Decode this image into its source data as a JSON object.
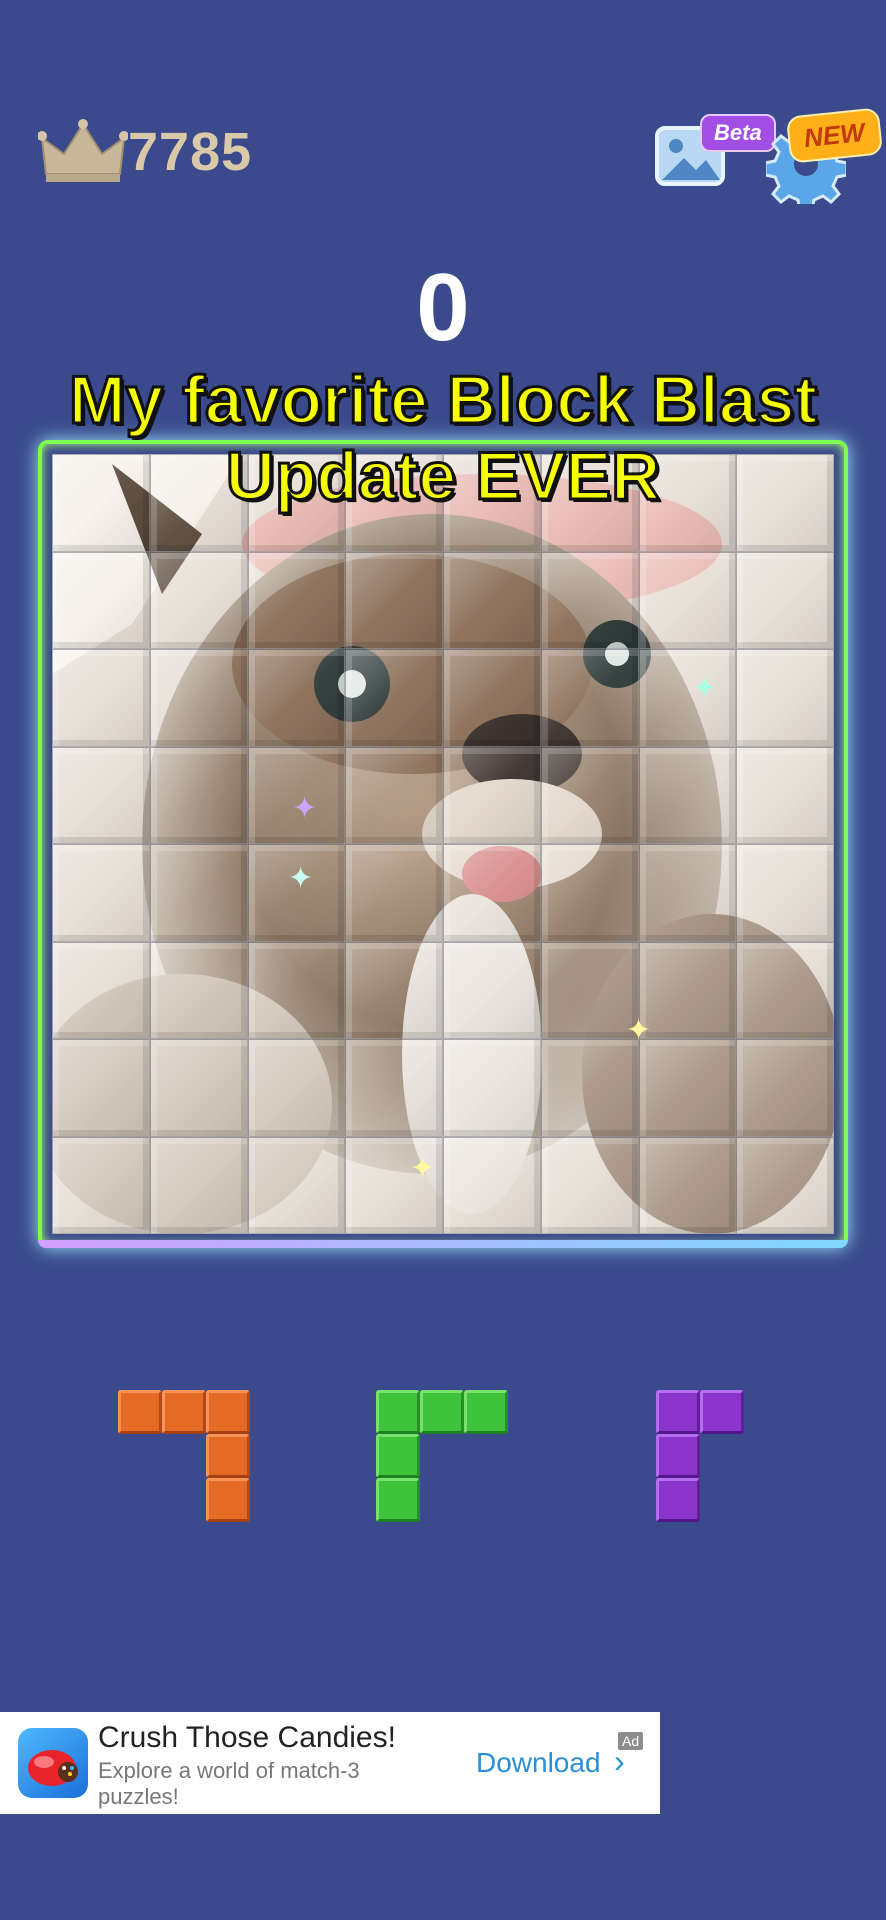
{
  "header": {
    "best_score": "7785",
    "crown_icon": "crown-icon",
    "gallery_icon": "image-gallery-icon",
    "gallery_badge": "Beta",
    "settings_icon": "gear-icon",
    "settings_badge": "NEW"
  },
  "game": {
    "score": "0",
    "board_size": "8x8",
    "board_image": "cat photo",
    "pieces": [
      {
        "color": "orange",
        "color_hex": "#e56b25",
        "shape": [
          [
            1,
            1,
            1
          ],
          [
            0,
            0,
            1
          ],
          [
            0,
            0,
            1
          ]
        ]
      },
      {
        "color": "green",
        "color_hex": "#3ec43a",
        "shape": [
          [
            1,
            1,
            1
          ],
          [
            1,
            0,
            0
          ],
          [
            1,
            0,
            0
          ]
        ]
      },
      {
        "color": "purple",
        "color_hex": "#8a34cc",
        "shape": [
          [
            1,
            1
          ],
          [
            1,
            0
          ],
          [
            1,
            0
          ]
        ]
      }
    ]
  },
  "overlay": {
    "caption_line1": "My favorite Block Blast",
    "caption_line2": "Update EVER"
  },
  "ad": {
    "title": "Crush Those Candies!",
    "description": "Explore a world of match-3 puzzles!",
    "cta": "Download",
    "tag": "Ad",
    "icon": "candy-crush-app-icon"
  },
  "colors": {
    "background": "#3a4a8c",
    "caption": "#f4ff00",
    "board_glow": "#7cff52",
    "link": "#2a8fd6"
  }
}
